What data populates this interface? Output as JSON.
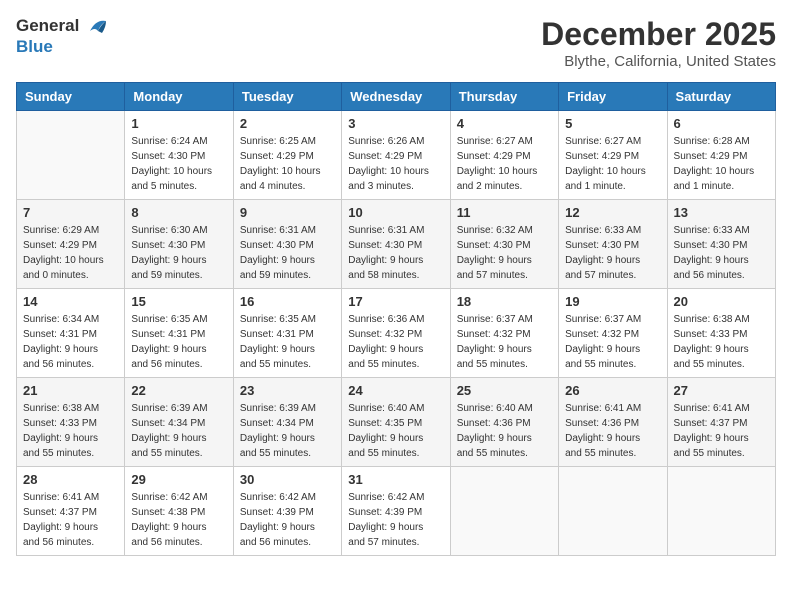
{
  "header": {
    "logo_line1": "General",
    "logo_line2": "Blue",
    "month": "December 2025",
    "location": "Blythe, California, United States"
  },
  "weekdays": [
    "Sunday",
    "Monday",
    "Tuesday",
    "Wednesday",
    "Thursday",
    "Friday",
    "Saturday"
  ],
  "weeks": [
    [
      {
        "day": "",
        "info": ""
      },
      {
        "day": "1",
        "info": "Sunrise: 6:24 AM\nSunset: 4:30 PM\nDaylight: 10 hours\nand 5 minutes."
      },
      {
        "day": "2",
        "info": "Sunrise: 6:25 AM\nSunset: 4:29 PM\nDaylight: 10 hours\nand 4 minutes."
      },
      {
        "day": "3",
        "info": "Sunrise: 6:26 AM\nSunset: 4:29 PM\nDaylight: 10 hours\nand 3 minutes."
      },
      {
        "day": "4",
        "info": "Sunrise: 6:27 AM\nSunset: 4:29 PM\nDaylight: 10 hours\nand 2 minutes."
      },
      {
        "day": "5",
        "info": "Sunrise: 6:27 AM\nSunset: 4:29 PM\nDaylight: 10 hours\nand 1 minute."
      },
      {
        "day": "6",
        "info": "Sunrise: 6:28 AM\nSunset: 4:29 PM\nDaylight: 10 hours\nand 1 minute."
      }
    ],
    [
      {
        "day": "7",
        "info": "Sunrise: 6:29 AM\nSunset: 4:29 PM\nDaylight: 10 hours\nand 0 minutes."
      },
      {
        "day": "8",
        "info": "Sunrise: 6:30 AM\nSunset: 4:30 PM\nDaylight: 9 hours\nand 59 minutes."
      },
      {
        "day": "9",
        "info": "Sunrise: 6:31 AM\nSunset: 4:30 PM\nDaylight: 9 hours\nand 59 minutes."
      },
      {
        "day": "10",
        "info": "Sunrise: 6:31 AM\nSunset: 4:30 PM\nDaylight: 9 hours\nand 58 minutes."
      },
      {
        "day": "11",
        "info": "Sunrise: 6:32 AM\nSunset: 4:30 PM\nDaylight: 9 hours\nand 57 minutes."
      },
      {
        "day": "12",
        "info": "Sunrise: 6:33 AM\nSunset: 4:30 PM\nDaylight: 9 hours\nand 57 minutes."
      },
      {
        "day": "13",
        "info": "Sunrise: 6:33 AM\nSunset: 4:30 PM\nDaylight: 9 hours\nand 56 minutes."
      }
    ],
    [
      {
        "day": "14",
        "info": "Sunrise: 6:34 AM\nSunset: 4:31 PM\nDaylight: 9 hours\nand 56 minutes."
      },
      {
        "day": "15",
        "info": "Sunrise: 6:35 AM\nSunset: 4:31 PM\nDaylight: 9 hours\nand 56 minutes."
      },
      {
        "day": "16",
        "info": "Sunrise: 6:35 AM\nSunset: 4:31 PM\nDaylight: 9 hours\nand 55 minutes."
      },
      {
        "day": "17",
        "info": "Sunrise: 6:36 AM\nSunset: 4:32 PM\nDaylight: 9 hours\nand 55 minutes."
      },
      {
        "day": "18",
        "info": "Sunrise: 6:37 AM\nSunset: 4:32 PM\nDaylight: 9 hours\nand 55 minutes."
      },
      {
        "day": "19",
        "info": "Sunrise: 6:37 AM\nSunset: 4:32 PM\nDaylight: 9 hours\nand 55 minutes."
      },
      {
        "day": "20",
        "info": "Sunrise: 6:38 AM\nSunset: 4:33 PM\nDaylight: 9 hours\nand 55 minutes."
      }
    ],
    [
      {
        "day": "21",
        "info": "Sunrise: 6:38 AM\nSunset: 4:33 PM\nDaylight: 9 hours\nand 55 minutes."
      },
      {
        "day": "22",
        "info": "Sunrise: 6:39 AM\nSunset: 4:34 PM\nDaylight: 9 hours\nand 55 minutes."
      },
      {
        "day": "23",
        "info": "Sunrise: 6:39 AM\nSunset: 4:34 PM\nDaylight: 9 hours\nand 55 minutes."
      },
      {
        "day": "24",
        "info": "Sunrise: 6:40 AM\nSunset: 4:35 PM\nDaylight: 9 hours\nand 55 minutes."
      },
      {
        "day": "25",
        "info": "Sunrise: 6:40 AM\nSunset: 4:36 PM\nDaylight: 9 hours\nand 55 minutes."
      },
      {
        "day": "26",
        "info": "Sunrise: 6:41 AM\nSunset: 4:36 PM\nDaylight: 9 hours\nand 55 minutes."
      },
      {
        "day": "27",
        "info": "Sunrise: 6:41 AM\nSunset: 4:37 PM\nDaylight: 9 hours\nand 55 minutes."
      }
    ],
    [
      {
        "day": "28",
        "info": "Sunrise: 6:41 AM\nSunset: 4:37 PM\nDaylight: 9 hours\nand 56 minutes."
      },
      {
        "day": "29",
        "info": "Sunrise: 6:42 AM\nSunset: 4:38 PM\nDaylight: 9 hours\nand 56 minutes."
      },
      {
        "day": "30",
        "info": "Sunrise: 6:42 AM\nSunset: 4:39 PM\nDaylight: 9 hours\nand 56 minutes."
      },
      {
        "day": "31",
        "info": "Sunrise: 6:42 AM\nSunset: 4:39 PM\nDaylight: 9 hours\nand 57 minutes."
      },
      {
        "day": "",
        "info": ""
      },
      {
        "day": "",
        "info": ""
      },
      {
        "day": "",
        "info": ""
      }
    ]
  ]
}
